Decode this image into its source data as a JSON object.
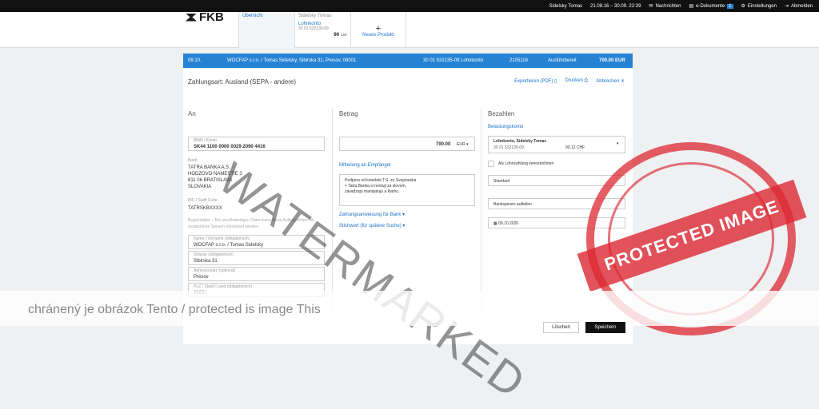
{
  "topbar": {
    "user": "Sidelsky Tomas",
    "period": "21.08.16 – 30.09. 22:39",
    "messages": "Nachrichten",
    "edocs": "e-Dokumente",
    "edocs_count": "1",
    "settings": "Einstellungen",
    "logout": "Abmelden"
  },
  "header": {
    "logo": "FKB",
    "tab_overview": "Übersicht",
    "account_owner": "Sidelsky Tomas",
    "account_name": "Lohnkonto",
    "account_number": "30 01 532135-09",
    "account_amount": "90",
    "account_currency": "CHF",
    "new_product": "Neues Produkt"
  },
  "band": {
    "date": "09.10.",
    "recipient": "WOCFAP s.r.o. / Tomas Sidelsky, Sibirska 31, Presov, 08001",
    "account": "30 01 532135-09 Lohnkonto",
    "ref": "2105116",
    "status": "Ausführbereit",
    "amount": "700.00 EUR"
  },
  "form": {
    "title": "Zahlungsart: Ausland (SEPA - andere)",
    "export": "Exportieren (PDF)",
    "print": "Drucken",
    "cancel": "Abbrechen",
    "an": "An",
    "iban_label": "IBAN / Konto",
    "iban": "SK44 1100 0000 0029 2090 4416",
    "bank_label": "Bank",
    "bank_lines": [
      "TATRA BANKA A.S.",
      "HODZOVO NAMESTIE 3",
      "811 06 BRATISLAVA",
      "SLOVAKIA"
    ],
    "bic_label": "BIC / Swift Code",
    "bic": "TATRSKBXXXX",
    "note": "Begünstigter – Bei unvollständigen Daten kann diese Auftrag fehlen mit zusätzlichen Spesen retourniert werden.",
    "name_label": "Name / Vorname (obligatorisch)",
    "name": "WOCFAP s.r.o. / Tomas Sidelsky",
    "street_label": "Strasse (obligatorisch)",
    "street": "Sibirska 31",
    "addr_label": "Adresszusatz (optional)",
    "addr": "Presov",
    "plz_label": "PLZ / Stadt / Land (obligatorisch)",
    "plz": "08001",
    "betrag": "Betrag",
    "amount": "700.00",
    "currency": "EUR",
    "mitteilung": "Mitteilung an Empfänger",
    "message": "Podpora od konelele T.S. ze Svajciarska + Tatra Banka si nestuji za slovom, zavadzaju manipuluju a klamu.",
    "zahlungsanweisung": "Zahlungsanweisung für Bank",
    "stichwort": "Stichwort (für spätere Suche)",
    "bezahlen": "Bezahlen",
    "belastung": "Belastungskonto",
    "acc_name": "Lohnkonto, Sidelsky Tomas",
    "acc_no": "30 01 532135-09",
    "acc_bal": "90.12 CHF",
    "lohnzahlung": "Als Lohnzahlung kennzeichnen",
    "standard": "Standard",
    "spesen": "Bankspesen aufteilen",
    "date": "09.10.2020",
    "btn_cancel": "Löschen",
    "btn_save": "Speichern"
  },
  "overlay": {
    "watermark": "WATERMARKED",
    "footer": "chránený je obrázok Tento / protected is image This",
    "stamp": "PROTECTED IMAGE"
  },
  "colors": {
    "accent": "#2683d4",
    "stamp": "#dc2832"
  }
}
